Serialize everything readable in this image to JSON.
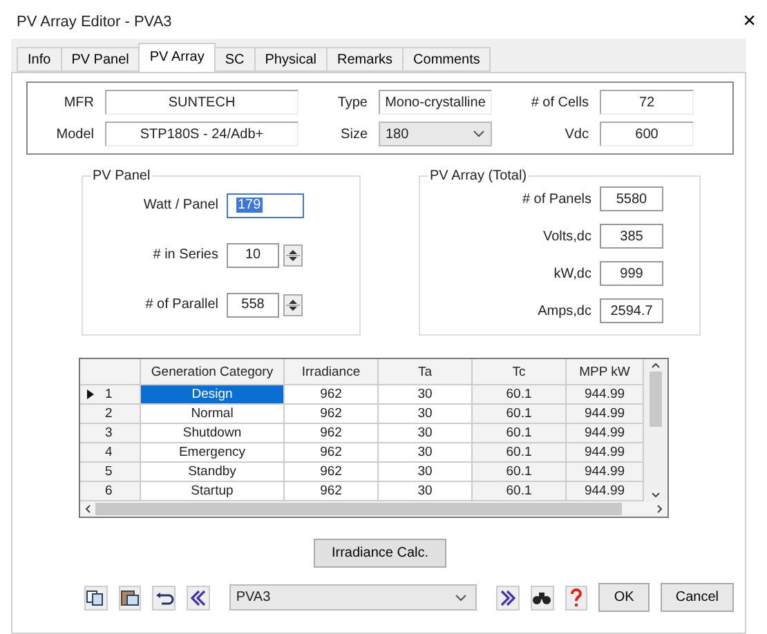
{
  "window": {
    "title": "PV Array Editor - PVA3",
    "close": "×"
  },
  "tabs": [
    {
      "label": "Info",
      "selected": false
    },
    {
      "label": "PV Panel",
      "selected": false
    },
    {
      "label": "PV Array",
      "selected": true
    },
    {
      "label": "SC",
      "selected": false
    },
    {
      "label": "Physical",
      "selected": false
    },
    {
      "label": "Remarks",
      "selected": false
    },
    {
      "label": "Comments",
      "selected": false
    }
  ],
  "header": {
    "mfr": {
      "label": "MFR",
      "value": "SUNTECH"
    },
    "model": {
      "label": "Model",
      "value": "STP180S - 24/Adb+"
    },
    "type": {
      "label": "Type",
      "value": "Mono-crystalline"
    },
    "size": {
      "label": "Size",
      "value": "180"
    },
    "cells": {
      "label": "# of Cells",
      "value": "72"
    },
    "vdc": {
      "label": "Vdc",
      "value": "600"
    }
  },
  "pv_panel": {
    "title": "PV Panel",
    "fields": [
      {
        "label": "Watt / Panel",
        "value": "179",
        "kind": "text",
        "selected": true
      },
      {
        "label": "# in Series",
        "value": "10",
        "kind": "spinner",
        "selected": false
      },
      {
        "label": "# of Parallel",
        "value": "558",
        "kind": "spinner",
        "selected": false
      }
    ]
  },
  "pv_array": {
    "title": "PV Array (Total)",
    "fields": [
      {
        "label": "# of Panels",
        "value": "5580"
      },
      {
        "label": "Volts,dc",
        "value": "385"
      },
      {
        "label": "kW,dc",
        "value": "999"
      },
      {
        "label": "Amps,dc",
        "value": "2594.7"
      }
    ]
  },
  "table": {
    "columns": [
      "Generation Category",
      "Irradiance",
      "Ta",
      "Tc",
      "MPP kW"
    ],
    "rows": [
      {
        "index": "1",
        "selected": true,
        "cells": [
          "Design",
          "962",
          "30",
          "60.1",
          "944.99"
        ]
      },
      {
        "index": "2",
        "selected": false,
        "cells": [
          "Normal",
          "962",
          "30",
          "60.1",
          "944.99"
        ]
      },
      {
        "index": "3",
        "selected": false,
        "cells": [
          "Shutdown",
          "962",
          "30",
          "60.1",
          "944.99"
        ]
      },
      {
        "index": "4",
        "selected": false,
        "cells": [
          "Emergency",
          "962",
          "30",
          "60.1",
          "944.99"
        ]
      },
      {
        "index": "5",
        "selected": false,
        "cells": [
          "Standby",
          "962",
          "30",
          "60.1",
          "944.99"
        ]
      },
      {
        "index": "6",
        "selected": false,
        "cells": [
          "Startup",
          "962",
          "30",
          "60.1",
          "944.99"
        ]
      }
    ]
  },
  "calc_button": "Irradiance Calc.",
  "footer": {
    "selector": "PVA3",
    "buttons": [
      "OK",
      "Cancel"
    ]
  }
}
